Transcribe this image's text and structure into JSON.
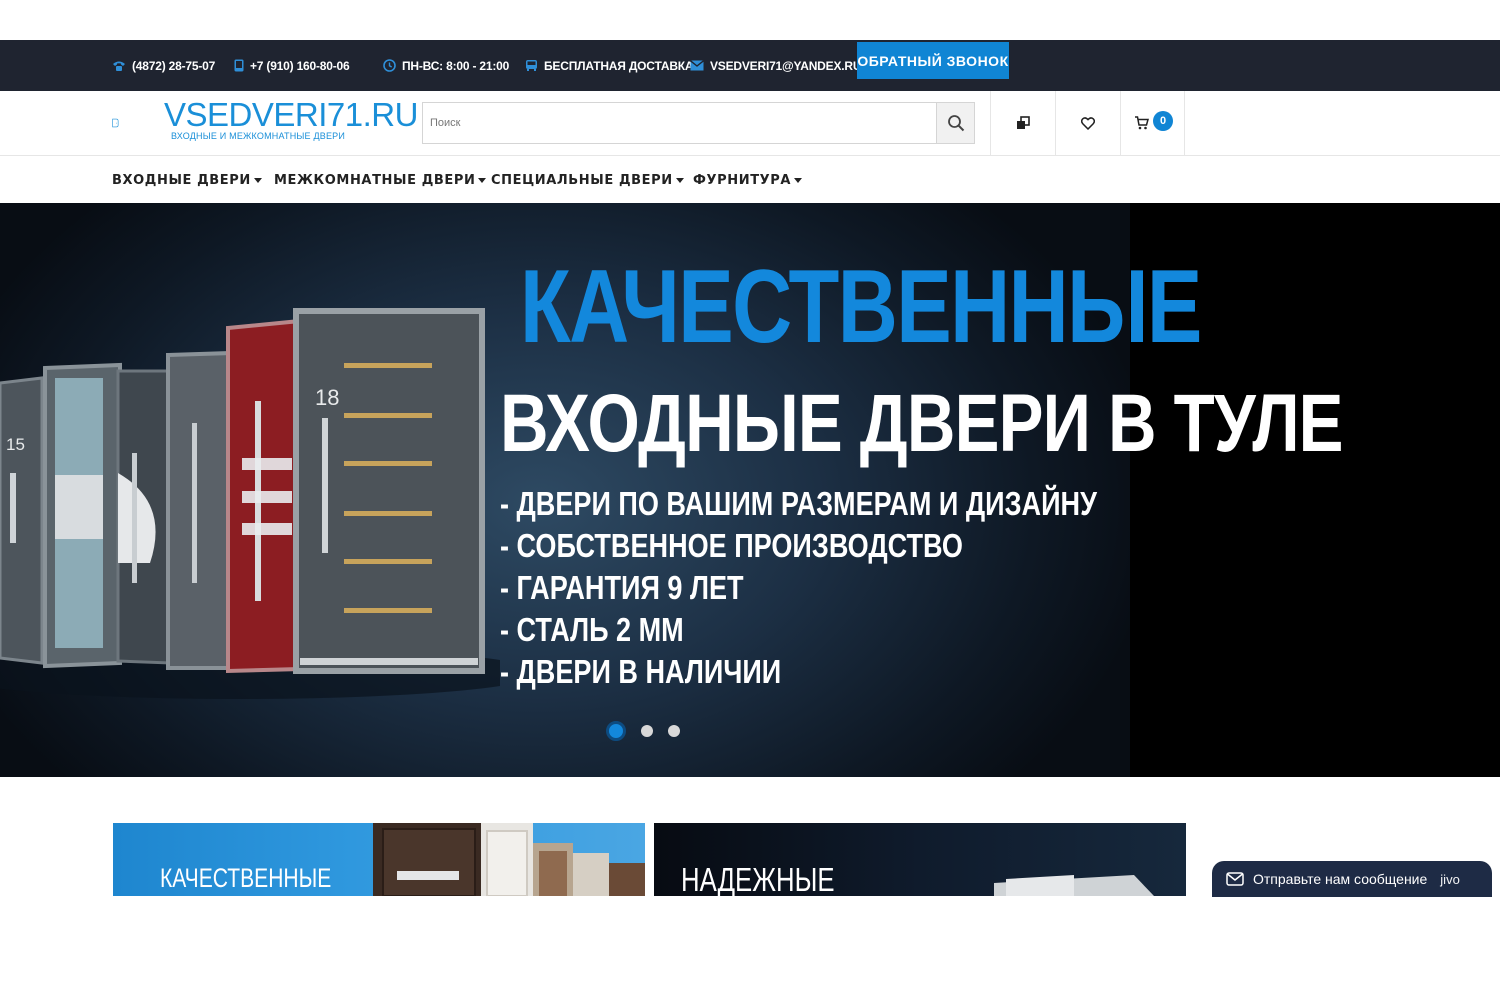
{
  "topbar": {
    "phone_landline": "(4872) 28-75-07",
    "phone_mobile": "+7 (910) 160-80-06",
    "hours": "ПН-ВС: 8:00 - 21:00",
    "delivery": "БЕСПЛАТНАЯ ДОСТАВКА",
    "email": "VSEDVERI71@YANDEX.RU",
    "callback_label": "ОБРАТНЫЙ ЗВОНОК"
  },
  "header": {
    "logo_text": "VSEDVERI71.RU",
    "logo_subtitle": "ВХОДНЫЕ И МЕЖКОМНАТНЫЕ ДВЕРИ",
    "search_placeholder": "Поиск",
    "cart_count": "0"
  },
  "nav": {
    "items": [
      {
        "label": "ВХОДНЫЕ ДВЕРИ"
      },
      {
        "label": "МЕЖКОМНАТНЫЕ ДВЕРИ"
      },
      {
        "label": "СПЕЦИАЛЬНЫЕ ДВЕРИ"
      },
      {
        "label": "ФУРНИТУРА"
      }
    ]
  },
  "hero": {
    "headline": "КАЧЕСТВЕННЫЕ",
    "subheadline": "ВХОДНЫЕ ДВЕРИ В ТУЛЕ",
    "bullets": [
      "- ДВЕРИ ПО ВАШИМ РАЗМЕРАМ И ДИЗАЙНУ",
      "- СОБСТВЕННОЕ ПРОИЗВОДСТВО",
      "- ГАРАНТИЯ 9 ЛЕТ",
      "- СТАЛЬ 2 ММ",
      "- ДВЕРИ В НАЛИЧИИ"
    ],
    "door_numbers": [
      "15",
      "18"
    ],
    "slides_total": 3,
    "active_slide": 1
  },
  "banners": [
    {
      "title": "КАЧЕСТВЕННЫЕ"
    },
    {
      "title": "НАДЕЖНЫЕ"
    }
  ],
  "chat": {
    "label": "Отправьте нам сообщение",
    "brand": "jivo"
  },
  "colors": {
    "accent": "#1085d4",
    "topbar_bg": "#1f2430",
    "hero_headline": "#1388dc"
  }
}
